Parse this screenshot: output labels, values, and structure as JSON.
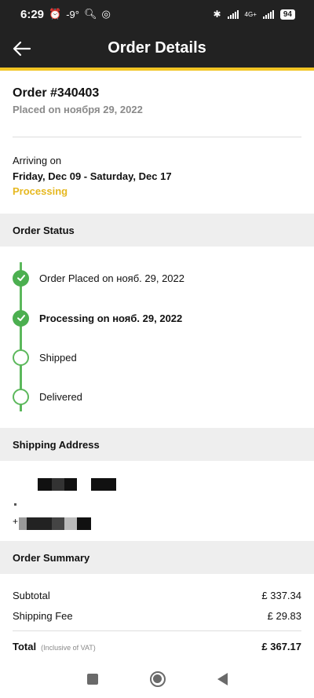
{
  "status_bar": {
    "time": "6:29",
    "temperature": "-9°",
    "network": "4G+",
    "battery": "94"
  },
  "app_bar": {
    "title": "Order Details",
    "back_icon": "arrow-left-icon"
  },
  "order": {
    "number": "Order #340403",
    "placed_on": "Placed on ноября 29, 2022"
  },
  "arrival": {
    "label": "Arriving on",
    "dates": "Friday, Dec 09 - Saturday, Dec 17",
    "status": "Processing"
  },
  "colors": {
    "accent": "#f2c524",
    "processing": "#e6b820",
    "success": "#4caf50",
    "appbar": "#222222"
  },
  "order_status": {
    "heading": "Order Status",
    "steps": [
      {
        "label": "Order Placed on нояб. 29, 2022",
        "state": "done"
      },
      {
        "label": "Processing on нояб. 29, 2022",
        "state": "done"
      },
      {
        "label": "Shipped",
        "state": "pending"
      },
      {
        "label": "Delivered",
        "state": "pending"
      }
    ]
  },
  "shipping": {
    "heading": "Shipping Address",
    "phone_prefix": "+"
  },
  "summary": {
    "heading": "Order Summary",
    "subtotal_label": "Subtotal",
    "subtotal_value": "£ 337.34",
    "shipping_label": "Shipping Fee",
    "shipping_value": "£ 29.83",
    "total_label": "Total",
    "vat_note": "(Inclusive of VAT)",
    "total_value": "£ 367.17"
  },
  "nav_bar": {
    "buttons": [
      "recents-square-icon",
      "home-circle-icon",
      "back-triangle-icon"
    ]
  }
}
